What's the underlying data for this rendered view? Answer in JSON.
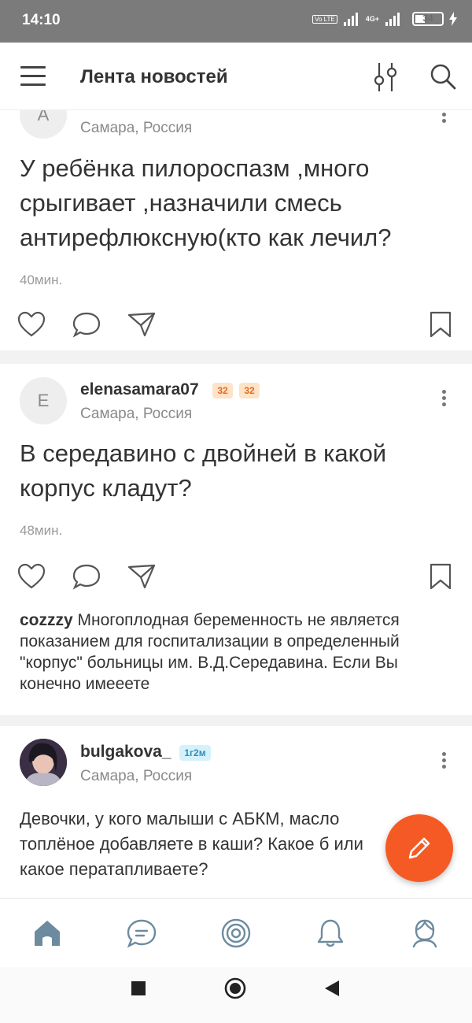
{
  "status_bar": {
    "time": "14:10",
    "volte": "Vo LTE",
    "net": "4G+",
    "battery": "34"
  },
  "header": {
    "title": "Лента новостей"
  },
  "posts": [
    {
      "avatar_letter": "A",
      "location": "Самара, Россия",
      "text": "У ребёнка пилороспазм ,много срыгивает  ,назначили смесь антирефлюксную(кто как лечил?",
      "time": "40мин."
    },
    {
      "avatar_letter": "E",
      "username": "elenasamara07",
      "badges": [
        "32",
        "32"
      ],
      "location": "Самара, Россия",
      "text": "В середавино с двойней в какой корпус кладут?",
      "time": "48мин.",
      "comment": {
        "author": "cozzzy",
        "text": " Многоплодная беременность не является показанием для госпитализации в определенный \"корпус\" больницы им. В.Д.Середавина. Если Вы конечно имееете"
      }
    },
    {
      "username": "bulgakova_",
      "badge": "1г2м",
      "location": "Самара, Россия",
      "text": "Девочки, у кого малыши с АБКМ, масло топлёное добавляете в каши? Какое б или какое ператапливаете?"
    }
  ],
  "colors": {
    "accent": "#f55a25",
    "badge_orange": "#fde3c8",
    "badge_blue": "#d5f1fb",
    "status_bar": "#7b7b7b"
  },
  "bottom_nav": [
    "home-icon",
    "chat-icon",
    "target-icon",
    "bell-icon",
    "profile-icon"
  ]
}
